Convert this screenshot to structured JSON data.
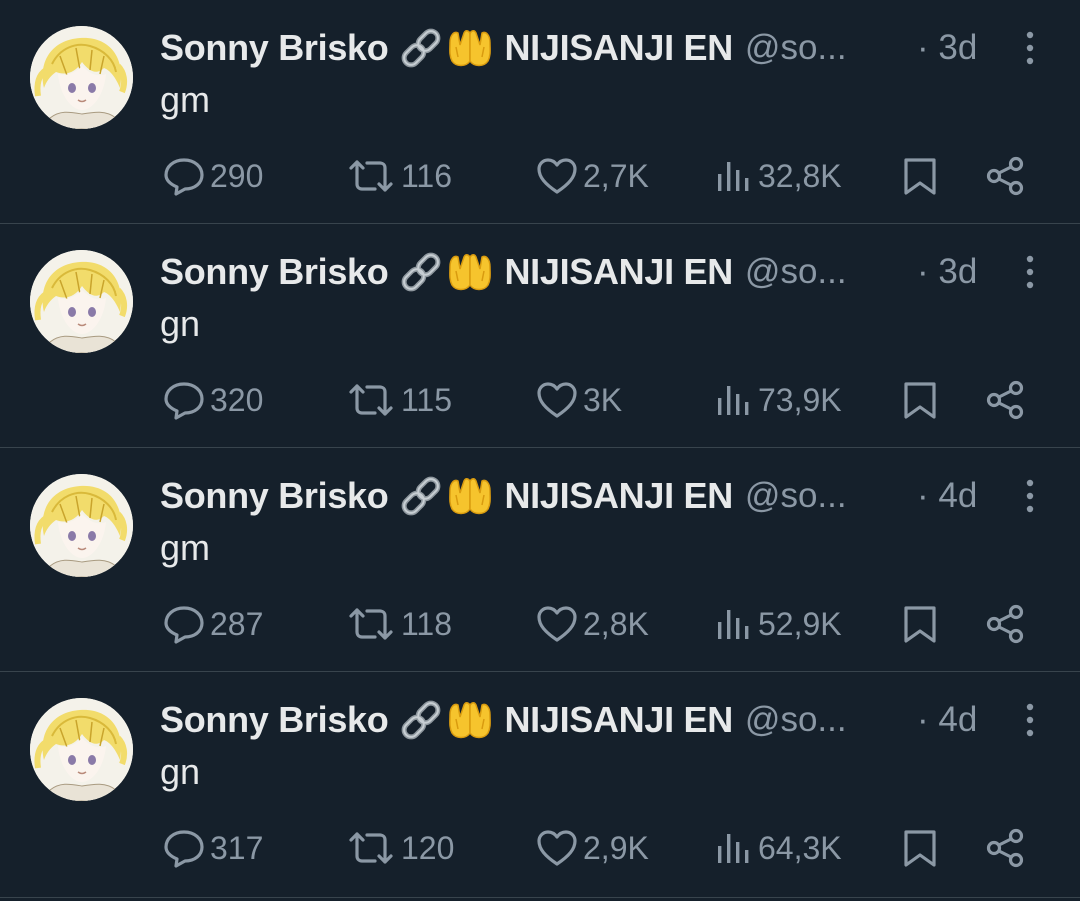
{
  "colors": {
    "background": "#15202b",
    "primary_text": "#e7e9ea",
    "secondary_text": "#8b98a5",
    "divider": "#38444d",
    "emoji_yellow": "#f6c42d"
  },
  "icons": {
    "reply": "speech-bubble-icon",
    "retweet": "retweet-arrows-icon",
    "like": "heart-icon",
    "views": "bar-chart-icon",
    "bookmark": "bookmark-icon",
    "share": "share-nodes-icon",
    "more": "vertical-ellipsis-icon",
    "name_emojis": [
      "link-emoji",
      "palms-up-together-emoji"
    ]
  },
  "tweets": [
    {
      "display_name": "Sonny Brisko",
      "affiliation": "NIJISANJI EN",
      "handle": "@so...",
      "time": "· 3d",
      "text": "gm",
      "replies": "290",
      "retweets": "116",
      "likes": "2,7K",
      "views": "32,8K"
    },
    {
      "display_name": "Sonny Brisko",
      "affiliation": "NIJISANJI EN",
      "handle": "@so...",
      "time": "· 3d",
      "text": "gn",
      "replies": "320",
      "retweets": "115",
      "likes": "3K",
      "views": "73,9K"
    },
    {
      "display_name": "Sonny Brisko",
      "affiliation": "NIJISANJI EN",
      "handle": "@so...",
      "time": "· 4d",
      "text": "gm",
      "replies": "287",
      "retweets": "118",
      "likes": "2,8K",
      "views": "52,9K"
    },
    {
      "display_name": "Sonny Brisko",
      "affiliation": "NIJISANJI EN",
      "handle": "@so...",
      "time": "· 4d",
      "text": "gn",
      "replies": "317",
      "retweets": "120",
      "likes": "2,9K",
      "views": "64,3K"
    }
  ]
}
